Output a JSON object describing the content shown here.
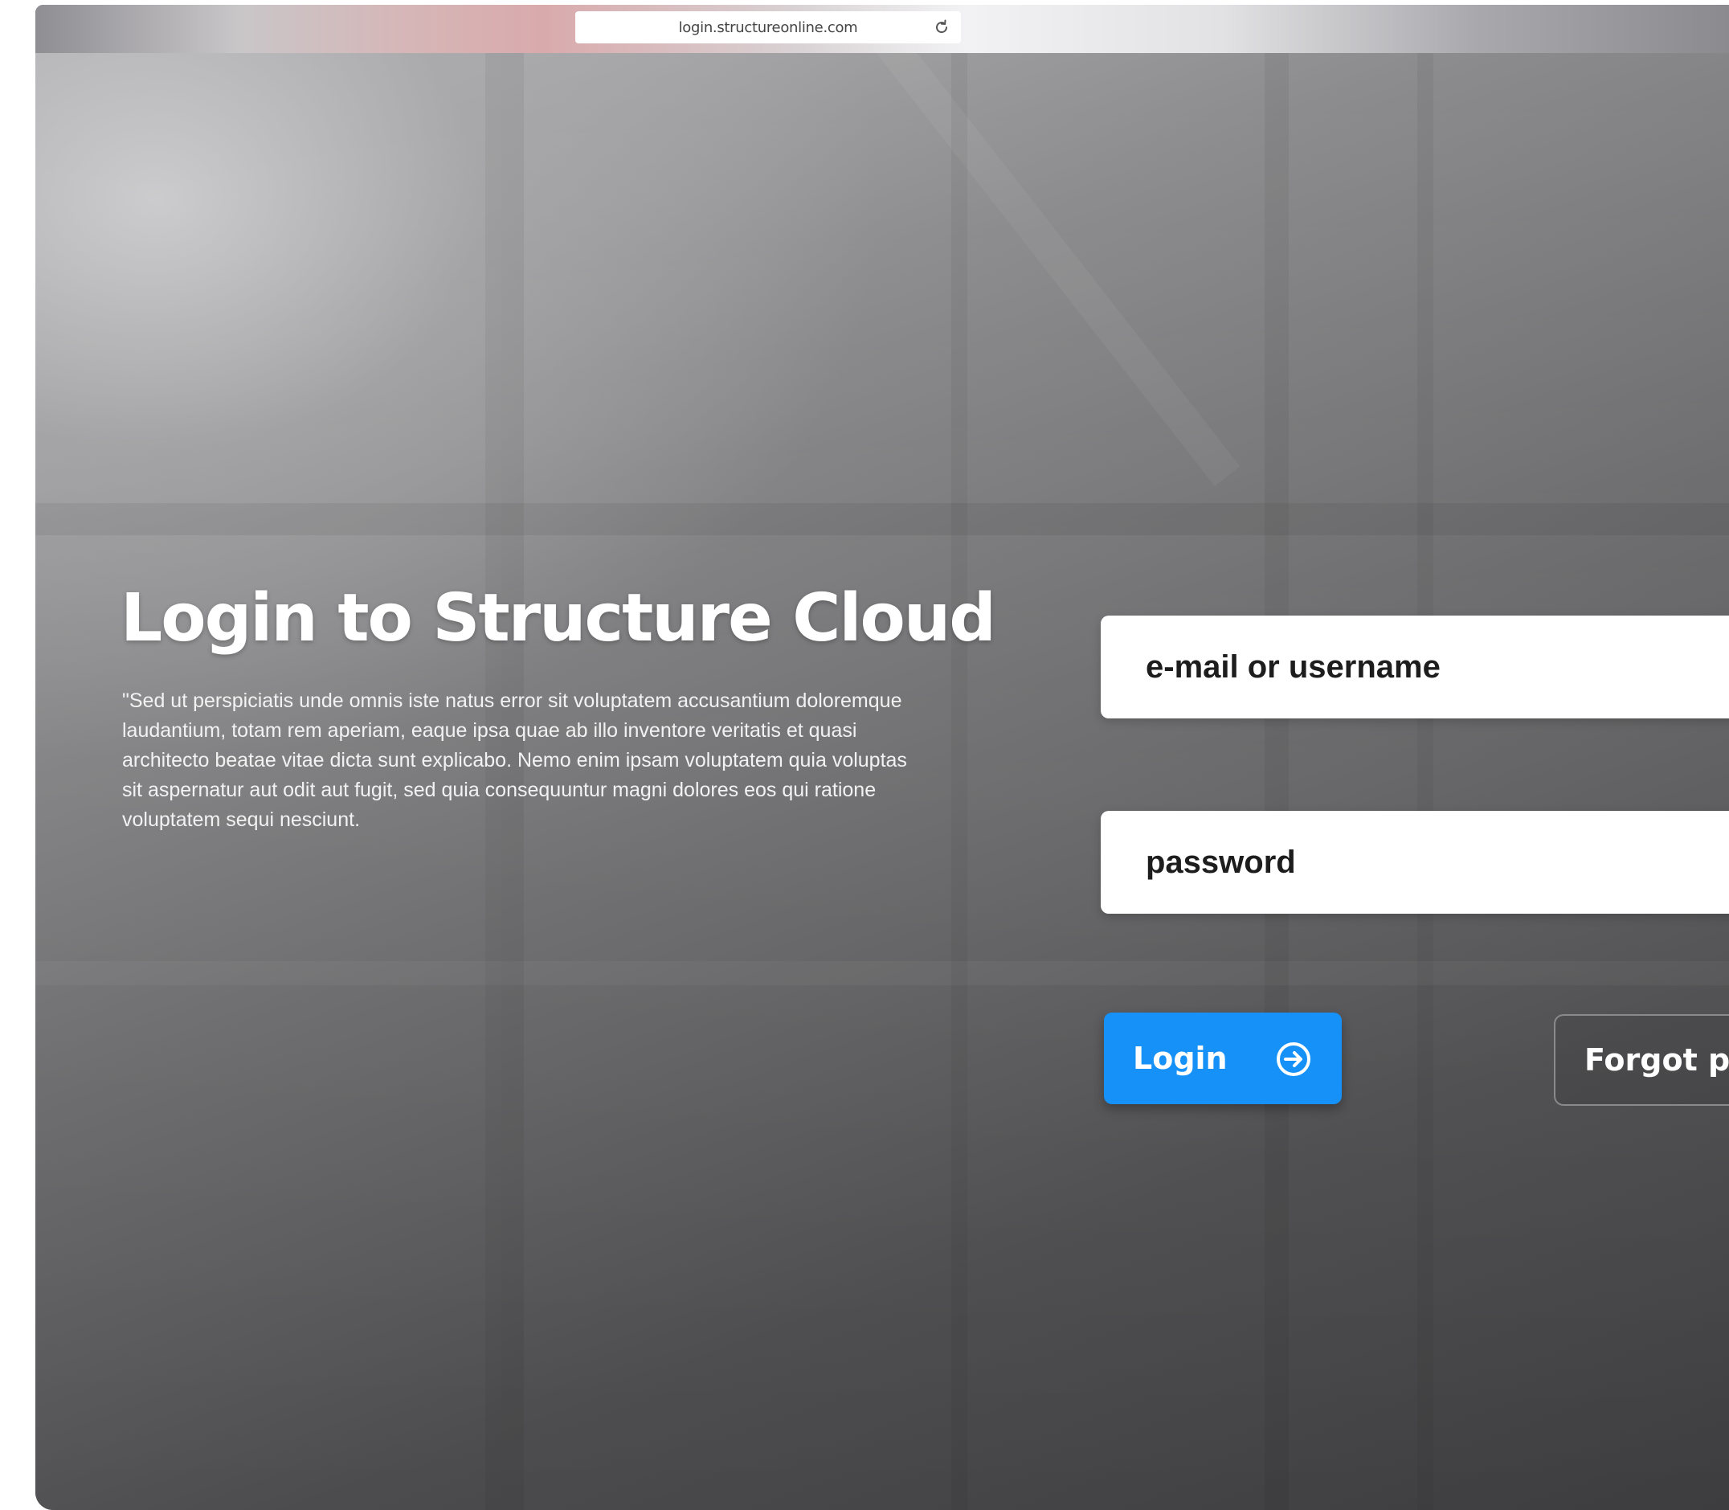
{
  "browser": {
    "url": "login.structureonline.com",
    "reload_icon": "reload-icon"
  },
  "login_page": {
    "title": "Login to Structure Cloud",
    "intro": "\"Sed ut perspiciatis unde omnis iste natus error sit voluptatem accusantium doloremque laudantium, totam rem aperiam, eaque ipsa quae ab illo inventore veritatis et quasi architecto beatae vitae dicta sunt explicabo. Nemo enim ipsam voluptatem quia voluptas sit aspernatur aut odit aut fugit, sed quia consequuntur magni dolores eos qui ratione voluptatem sequi nesciunt.",
    "username_placeholder": "e-mail or username",
    "password_placeholder": "password",
    "login_label": "Login",
    "login_icon": "arrow-right-circle-icon",
    "forgot_label": "Forgot pa"
  },
  "colors": {
    "login_button": "#1591f7",
    "text_on_dark": "#ffffff"
  }
}
